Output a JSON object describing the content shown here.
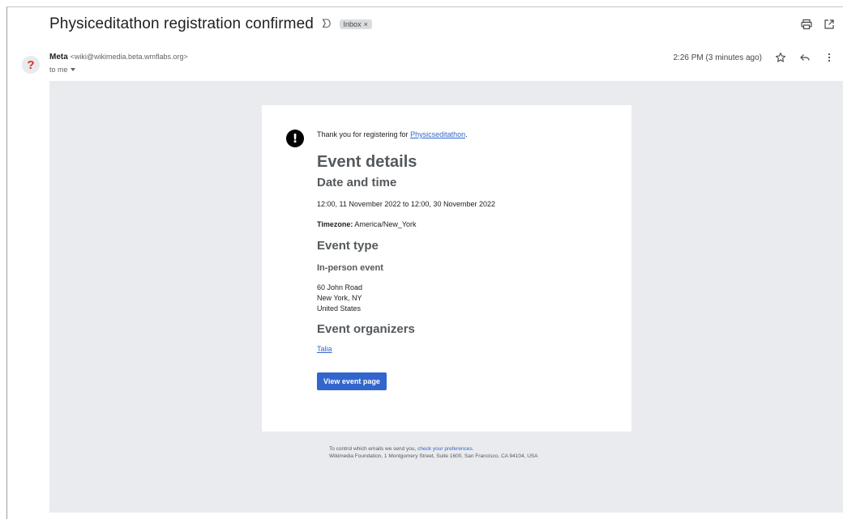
{
  "subject": {
    "title": "Physiceditathon registration confirmed",
    "label": "Inbox"
  },
  "sender": {
    "name": "Meta",
    "email": "<wiki@wikimedia.beta.wmflabs.org>",
    "to": "to me",
    "avatar_glyph": "?",
    "timestamp": "2:26 PM (3 minutes ago)"
  },
  "email": {
    "intro_text": "Thank you for registering for ",
    "intro_link": "Physicseditathon",
    "event_details_heading": "Event details",
    "date_time_heading": "Date and time",
    "date_time_value": "12:00, 11 November 2022 to 12:00, 30 November 2022",
    "timezone_label": "Timezone:",
    "timezone_value": "America/New_York",
    "event_type_heading": "Event type",
    "event_type_value": "In-person event",
    "address": [
      "60 John Road",
      "New York, NY",
      "United States"
    ],
    "organizers_heading": "Event organizers",
    "organizer": "Talia",
    "button_label": "View event page"
  },
  "footer": {
    "line1_text": "To control which emails we send you, ",
    "line1_link": "check your preferences",
    "line1_end": ".",
    "line2": "Wikimedia Foundation, 1 Montgomery Street, Suite 1600, San Francisco, CA 94104, USA"
  },
  "colors": {
    "link": "#3366cc",
    "button": "#3366cc",
    "email_background": "#eaebee"
  }
}
